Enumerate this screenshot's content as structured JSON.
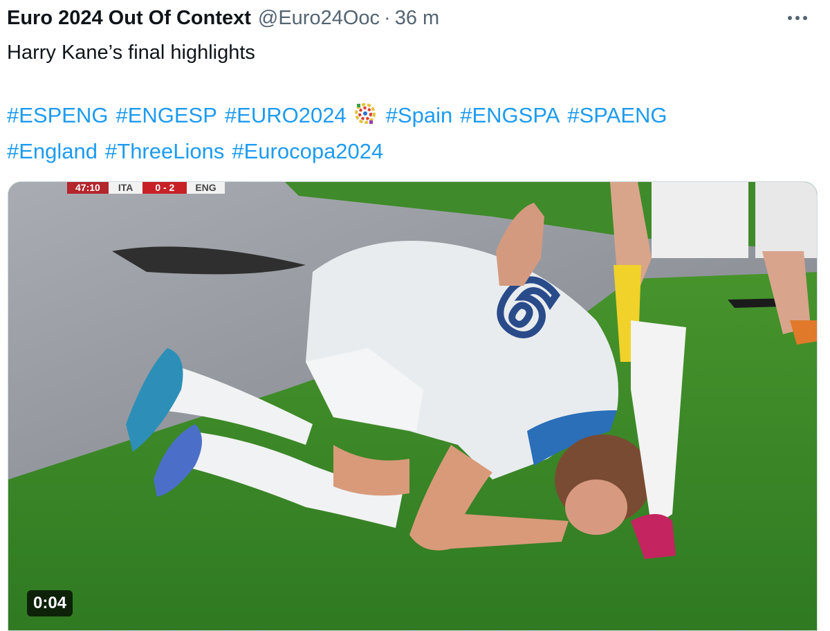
{
  "tweet": {
    "author_name": "Euro 2024 Out Of Context",
    "handle": "@Euro24Ooc",
    "separator": "·",
    "time": "36 m",
    "text": "Harry Kane’s final highlights",
    "hashtags_line1": [
      "#ESPENG",
      "#ENGESP",
      "#EURO2024"
    ],
    "hashtags_line1b": [
      "#Spain",
      "#ENGSPA",
      "#SPAENG"
    ],
    "hashtags_line2": [
      "#England",
      "#ThreeLions",
      "#Eurocopa2024"
    ]
  },
  "media": {
    "duration": "0:04",
    "scorebug": {
      "clock": "47:10",
      "team_a": "ITA",
      "score": "0 - 2",
      "team_b": "ENG"
    }
  },
  "icons": {
    "more": "more-horizontal-icon",
    "euro_logo": "euro2024-emoji-icon"
  }
}
